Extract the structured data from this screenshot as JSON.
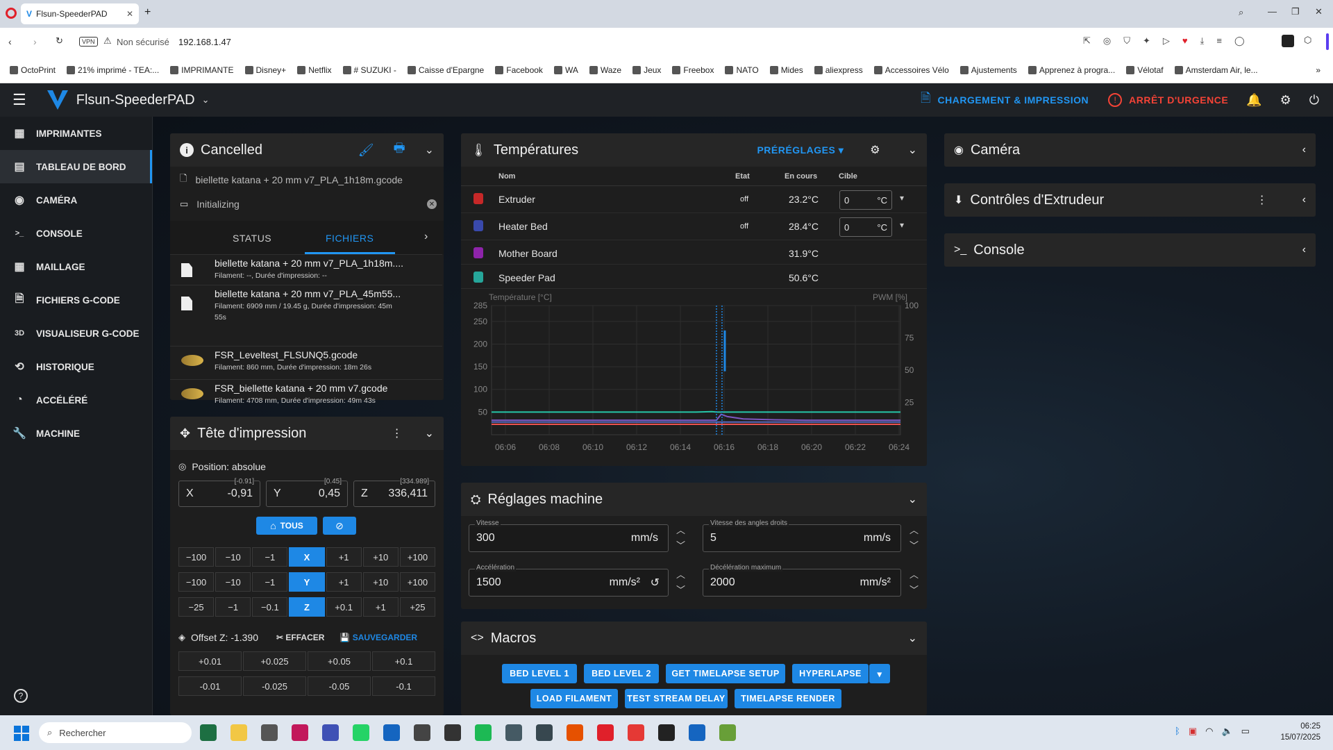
{
  "browser": {
    "tab_title": "Flsun-SpeederPAD",
    "vpn": "VPN",
    "security": "Non sécurisé",
    "url": "192.168.1.47",
    "bookmarks": [
      "OctoPrint",
      "21% imprimé - TEA:...",
      "IMPRIMANTE",
      "Disney+",
      "Netflix",
      "# SUZUKI -",
      "Caisse d'Epargne",
      "Facebook",
      "WA",
      "Waze",
      "Jeux",
      "Freebox",
      "NATO",
      "Mides",
      "aliexpress",
      "Accessoires Vélo",
      "Ajustements",
      "Apprenez à progra...",
      "Vélotaf",
      "Amsterdam Air, le..."
    ]
  },
  "header": {
    "title": "Flsun-SpeederPAD",
    "load_print": "CHARGEMENT & IMPRESSION",
    "emergency": "ARRÊT D'URGENCE"
  },
  "sidebar": {
    "items": [
      {
        "label": "IMPRIMANTES",
        "icon": "printers-icon"
      },
      {
        "label": "TABLEAU DE BORD",
        "icon": "dashboard-icon"
      },
      {
        "label": "CAMÉRA",
        "icon": "camera-icon"
      },
      {
        "label": "CONSOLE",
        "icon": "console-icon"
      },
      {
        "label": "MAILLAGE",
        "icon": "mesh-icon"
      },
      {
        "label": "FICHIERS G-CODE",
        "icon": "files-icon"
      },
      {
        "label": "VISUALISEUR G-CODE",
        "icon": "viewer-3d-icon"
      },
      {
        "label": "HISTORIQUE",
        "icon": "history-icon"
      },
      {
        "label": "ACCÉLÉRÉ",
        "icon": "timelapse-icon"
      },
      {
        "label": "MACHINE",
        "icon": "wrench-icon"
      }
    ]
  },
  "status": {
    "title": "Cancelled",
    "file": "biellette katana + 20 mm v7_PLA_1h18m.gcode",
    "message": "Initializing",
    "tabs": [
      "STATUS",
      "FICHIERS"
    ],
    "files": [
      {
        "name": "biellette katana + 20 mm v7_PLA_1h18m....",
        "meta": "Filament: --, Durée d'impression: --"
      },
      {
        "name": "biellette katana + 20 mm v7_PLA_45m55...",
        "meta": "Filament: 6909 mm / 19.45 g, Durée d'impression: 45m",
        "meta2": "55s"
      },
      {
        "name": "FSR_Leveltest_FLSUNQ5.gcode",
        "meta": "Filament: 860 mm, Durée d'impression: 18m 26s"
      },
      {
        "name": "FSR_biellette katana + 20 mm v7.gcode",
        "meta": "Filament: 4708 mm, Durée d'impression: 49m 43s"
      }
    ]
  },
  "toolhead": {
    "title": "Tête d'impression",
    "position_label": "Position: absolue",
    "x": {
      "label": "X",
      "value": "-0,91",
      "hint": "[-0.91]"
    },
    "y": {
      "label": "Y",
      "value": "0,45",
      "hint": "[0.45]"
    },
    "z": {
      "label": "Z",
      "value": "336,411",
      "hint": "[334.989]"
    },
    "home_all": "TOUS",
    "jog_x": [
      "−100",
      "−10",
      "−1",
      "X",
      "+1",
      "+10",
      "+100"
    ],
    "jog_y": [
      "−100",
      "−10",
      "−1",
      "Y",
      "+1",
      "+10",
      "+100"
    ],
    "jog_z": [
      "−25",
      "−1",
      "−0.1",
      "Z",
      "+0.1",
      "+1",
      "+25"
    ],
    "offset_label": "Offset Z: -1.390",
    "clear": "EFFACER",
    "save": "SAUVEGARDER",
    "offset_up": [
      "+0.01",
      "+0.025",
      "+0.05",
      "+0.1"
    ],
    "offset_down": [
      "-0.01",
      "-0.025",
      "-0.05",
      "-0.1"
    ]
  },
  "temps": {
    "title": "Températures",
    "presets": "PRÉRÉGLAGES",
    "cols": [
      "Nom",
      "Etat",
      "En cours",
      "Cible"
    ],
    "rows": [
      {
        "name": "Extruder",
        "state": "off",
        "current": "23.2°C",
        "target": "0",
        "unit": "°C"
      },
      {
        "name": "Heater Bed",
        "state": "off",
        "current": "28.4°C",
        "target": "0",
        "unit": "°C"
      },
      {
        "name": "Mother Board",
        "current": "31.9°C"
      },
      {
        "name": "Speeder Pad",
        "current": "50.6°C"
      }
    ]
  },
  "chart_data": {
    "type": "line",
    "ylabel": "Température [°C]",
    "y2label": "PWM [%]",
    "yticks": [
      50,
      100,
      150,
      200,
      250,
      285
    ],
    "y2ticks": [
      25,
      50,
      75,
      100
    ],
    "ylim": [
      0,
      285
    ],
    "xticks": [
      "06:06",
      "06:08",
      "06:10",
      "06:12",
      "06:14",
      "06:16",
      "06:18",
      "06:20",
      "06:22",
      "06:24"
    ],
    "x": [
      0,
      2,
      4,
      6,
      8,
      10,
      12,
      13,
      14,
      14.3,
      14.6,
      15,
      16,
      18,
      20,
      22,
      24,
      26
    ],
    "series": [
      {
        "color": "#26c6a9",
        "values": [
          50,
          50,
          50,
          50,
          50,
          50,
          50,
          50,
          51,
          50,
          50,
          50,
          50,
          50,
          50,
          50,
          50,
          50
        ]
      },
      {
        "color": "#7e57c2",
        "values": [
          32,
          32,
          32,
          32,
          32,
          32,
          32,
          32,
          32,
          32,
          45,
          40,
          35,
          33,
          32,
          32,
          32,
          32
        ]
      },
      {
        "color": "#ef5350",
        "values": [
          23,
          23,
          23,
          23,
          23,
          23,
          23,
          23,
          23,
          23,
          23,
          23,
          23,
          23,
          23,
          23,
          23,
          23
        ]
      },
      {
        "color": "#5c6bc0",
        "values": [
          28,
          28,
          28,
          28,
          28,
          28,
          28,
          28,
          28,
          28,
          28,
          28,
          28,
          28,
          28,
          28,
          28,
          28
        ]
      },
      {
        "color": "#1e88e5",
        "values": [
          null,
          null,
          null,
          null,
          null,
          null,
          null,
          null,
          null,
          285,
          null,
          null,
          null,
          null,
          null,
          null,
          null,
          null
        ]
      }
    ],
    "grid": true
  },
  "machine": {
    "title": "Réglages machine",
    "speed": {
      "label": "Vitesse",
      "value": "300",
      "unit": "mm/s"
    },
    "scv": {
      "label": "Vitesse des angles droits",
      "value": "5",
      "unit": "mm/s"
    },
    "accel": {
      "label": "Accélération",
      "value": "1500",
      "unit": "mm/s²"
    },
    "decel": {
      "label": "Décélération maximum",
      "value": "2000",
      "unit": "mm/s²"
    }
  },
  "macros": {
    "title": "Macros",
    "buttons": [
      "BED LEVEL 1",
      "BED LEVEL 2",
      "GET TIMELAPSE SETUP",
      "HYPERLAPSE",
      "LOAD FILAMENT",
      "TEST STREAM DELAY",
      "TIMELAPSE RENDER"
    ]
  },
  "right": {
    "camera": "Caméra",
    "extruder": "Contrôles d'Extrudeur",
    "console": "Console"
  },
  "taskbar": {
    "search": "Rechercher",
    "time": "06:25",
    "date": "15/07/2025"
  }
}
